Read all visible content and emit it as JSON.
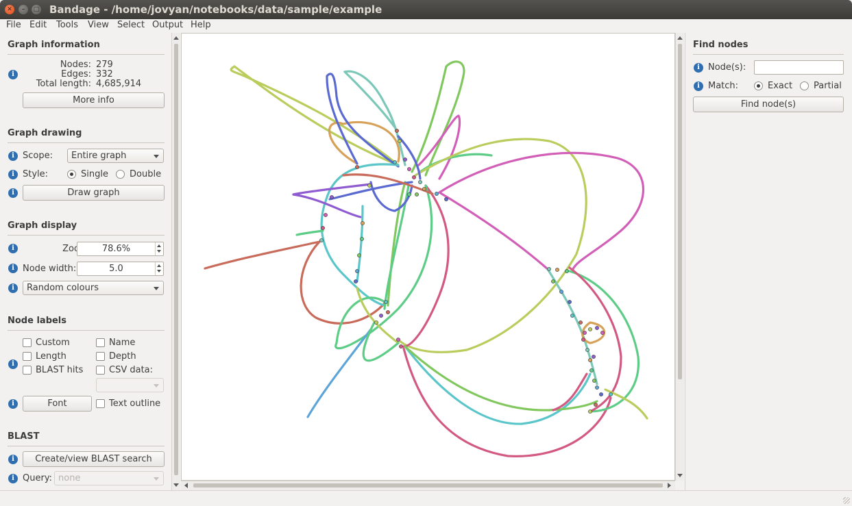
{
  "window": {
    "title": "Bandage - /home/jovyan/notebooks/data/sample/example"
  },
  "menu": [
    "File",
    "Edit",
    "Tools",
    "View",
    "Select",
    "Output",
    "Help"
  ],
  "graph_information": {
    "title": "Graph information",
    "nodes_label": "Nodes:",
    "nodes_value": "279",
    "edges_label": "Edges:",
    "edges_value": "332",
    "length_label": "Total length:",
    "length_value": "4,685,914",
    "more_info_button": "More info"
  },
  "graph_drawing": {
    "title": "Graph drawing",
    "scope_label": "Scope:",
    "scope_value": "Entire graph",
    "style_label": "Style:",
    "style_single": "Single",
    "style_double": "Double",
    "draw_button": "Draw graph",
    "style_selected": "Single"
  },
  "graph_display": {
    "title": "Graph display",
    "zoom_label": "Zoom:",
    "zoom_value": "78.6%",
    "node_width_label": "Node width:",
    "node_width_value": "5.0",
    "colour_scheme": "Random colours"
  },
  "node_labels": {
    "title": "Node labels",
    "custom": "Custom",
    "name": "Name",
    "length": "Length",
    "depth": "Depth",
    "blast_hits": "BLAST hits",
    "csv_data": "CSV data:",
    "font_button": "Font",
    "text_outline": "Text outline"
  },
  "blast": {
    "title": "BLAST",
    "search_button": "Create/view BLAST search",
    "query_label": "Query:",
    "query_value": "none"
  },
  "find_nodes": {
    "title": "Find nodes",
    "nodes_label": "Node(s):",
    "nodes_value": "",
    "match_label": "Match:",
    "match_exact": "Exact",
    "match_partial": "Partial",
    "match_selected": "Exact",
    "find_button": "Find node(s)"
  },
  "graph_colors": [
    "#c96b5a",
    "#7bc8b8",
    "#5a6ad0",
    "#d25fb7",
    "#80c75e",
    "#b9cc5c",
    "#d6a25a",
    "#5bc6c9",
    "#d25a82",
    "#5da5d6",
    "#8f5bd0",
    "#5dcc86"
  ]
}
